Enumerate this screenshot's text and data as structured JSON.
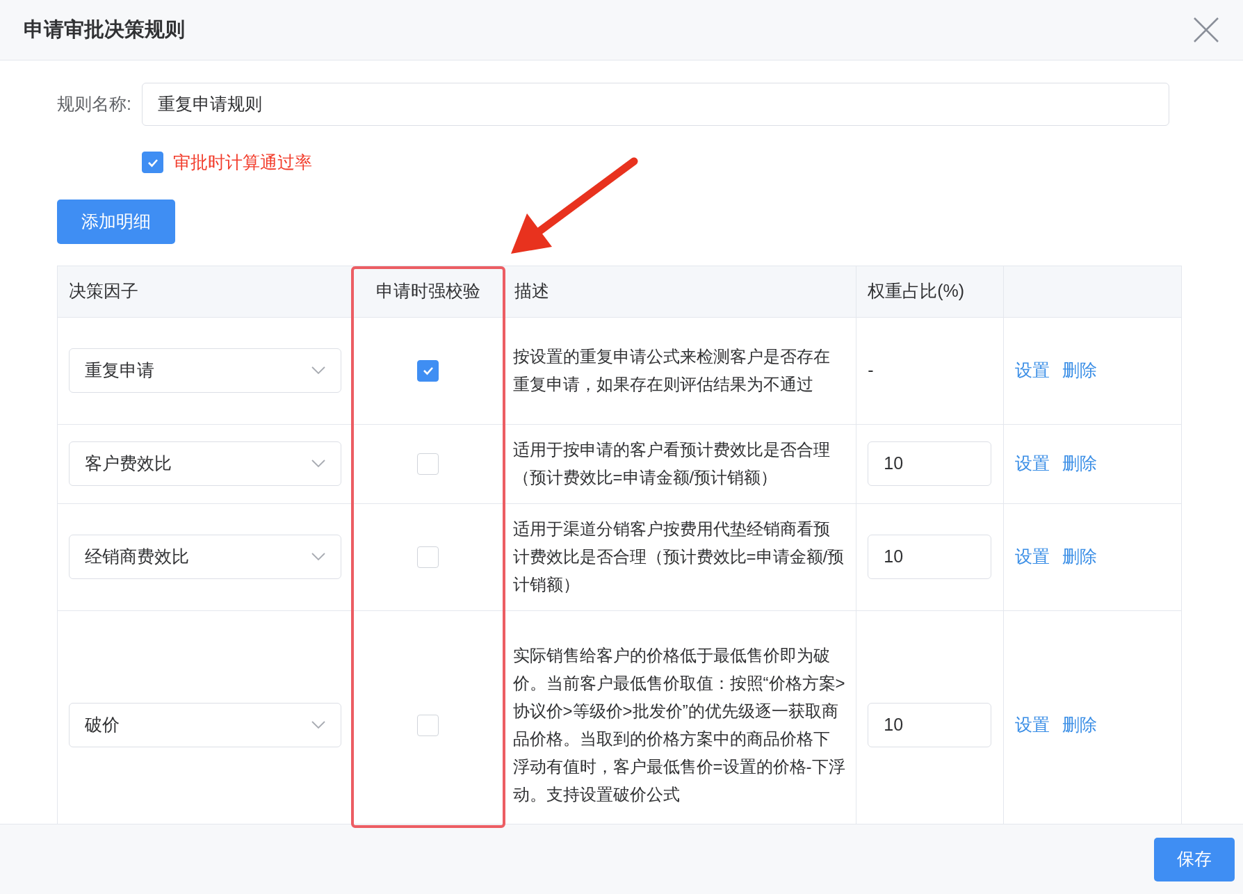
{
  "dialog": {
    "title": "申请审批决策规则"
  },
  "form": {
    "name_label": "规则名称:",
    "name_value": "重复申请规则",
    "calc_pass_rate": {
      "label": "审批时计算通过率",
      "checked": true
    }
  },
  "add_button": "添加明细",
  "table": {
    "columns": [
      "决策因子",
      "申请时强校验",
      "描述",
      "权重占比(%)"
    ],
    "rows": [
      {
        "factor": "重复申请",
        "strong_check": true,
        "description": "按设置的重复申请公式来检测客户是否存在重复申请，如果存在则评估结果为不通过",
        "weight": {
          "kind": "text",
          "value": "-"
        },
        "actions": [
          "设置",
          "删除"
        ]
      },
      {
        "factor": "客户费效比",
        "strong_check": false,
        "description": "适用于按申请的客户看预计费效比是否合理（预计费效比=申请金额/预计销额）",
        "weight": {
          "kind": "input",
          "value": "10"
        },
        "actions": [
          "设置",
          "删除"
        ]
      },
      {
        "factor": "经销商费效比",
        "strong_check": false,
        "description": "适用于渠道分销客户按费用代垫经销商看预计费效比是否合理（预计费效比=申请金额/预计销额）",
        "weight": {
          "kind": "input",
          "value": "10"
        },
        "actions": [
          "设置",
          "删除"
        ]
      },
      {
        "factor": "破价",
        "strong_check": false,
        "description": "实际销售给客户的价格低于最低售价即为破价。当前客户最低售价取值：按照“价格方案>协议价>等级价>批发价”的优先级逐一获取商品价格。当取到的价格方案中的商品价格下浮动有值时，客户最低售价=设置的价格-下浮动。支持设置破价公式",
        "weight": {
          "kind": "input",
          "value": "10"
        },
        "actions": [
          "设置",
          "删除"
        ]
      }
    ]
  },
  "footer": {
    "save_button": "保存"
  }
}
